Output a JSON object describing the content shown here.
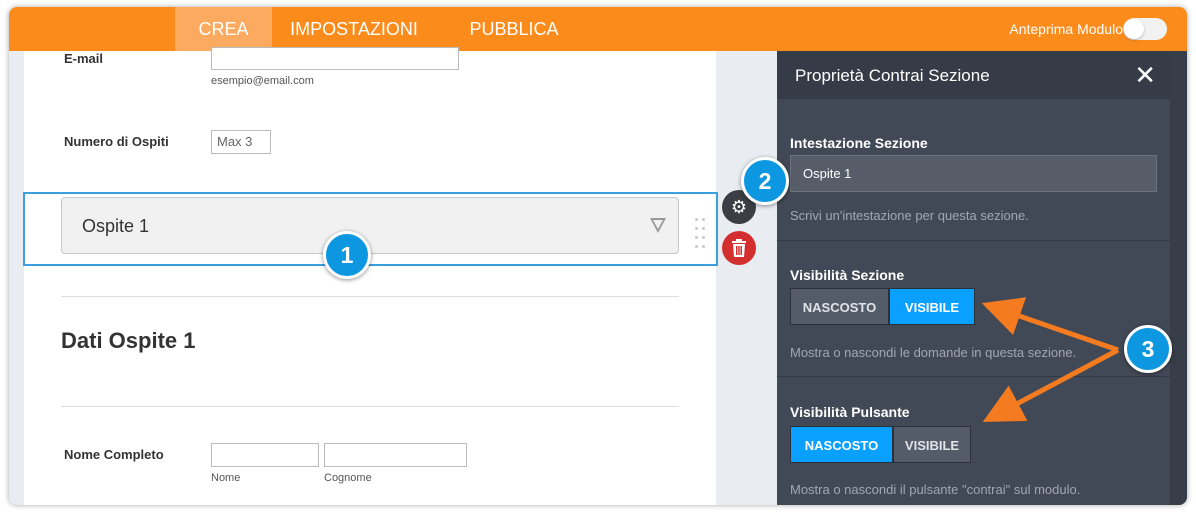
{
  "topbar": {
    "tabs": [
      {
        "label": "CREA",
        "active": true
      },
      {
        "label": "IMPOSTAZIONI",
        "active": false
      },
      {
        "label": "PUBBLICA",
        "active": false
      }
    ],
    "preview_label": "Anteprima Modulo",
    "preview_toggle_on": false
  },
  "form": {
    "email": {
      "label": "E-mail",
      "sublabel": "esempio@email.com"
    },
    "guests": {
      "label": "Numero di Ospiti",
      "value": "Max 3"
    },
    "collapse_title": "Ospite 1",
    "heading": "Dati Ospite 1",
    "full_name": {
      "label": "Nome Completo",
      "first_sublabel": "Nome",
      "last_sublabel": "Cognome"
    }
  },
  "tools": {
    "settings_icon": "gear-icon",
    "delete_icon": "trash-icon"
  },
  "panel": {
    "title": "Proprietà Contrai Sezione",
    "close_icon": "close-icon",
    "header_section": {
      "title": "Intestazione Sezione",
      "value": "Ospite 1",
      "description": "Scrivi un'intestazione per questa sezione."
    },
    "section_visibility": {
      "title": "Visibilità Sezione",
      "options": [
        "NASCOSTO",
        "VISIBILE"
      ],
      "selected": "VISIBILE",
      "description": "Mostra o nascondi le domande in questa sezione."
    },
    "button_visibility": {
      "title": "Visibilità Pulsante",
      "options": [
        "NASCOSTO",
        "VISIBILE"
      ],
      "selected": "NASCOSTO",
      "description": "Mostra o nascondi il pulsante \"contrai\" sul modulo."
    }
  },
  "badges": [
    "1",
    "2",
    "3"
  ],
  "colors": {
    "topbar": "#fb8c1c",
    "active_tab": "#fbaa60",
    "panel_bg": "#424956",
    "selected_button": "#0aa0ff",
    "badge": "#0d97e0",
    "arrow": "#f47b20",
    "delete": "#d32f2f",
    "selection_border": "#3ba0e0"
  }
}
